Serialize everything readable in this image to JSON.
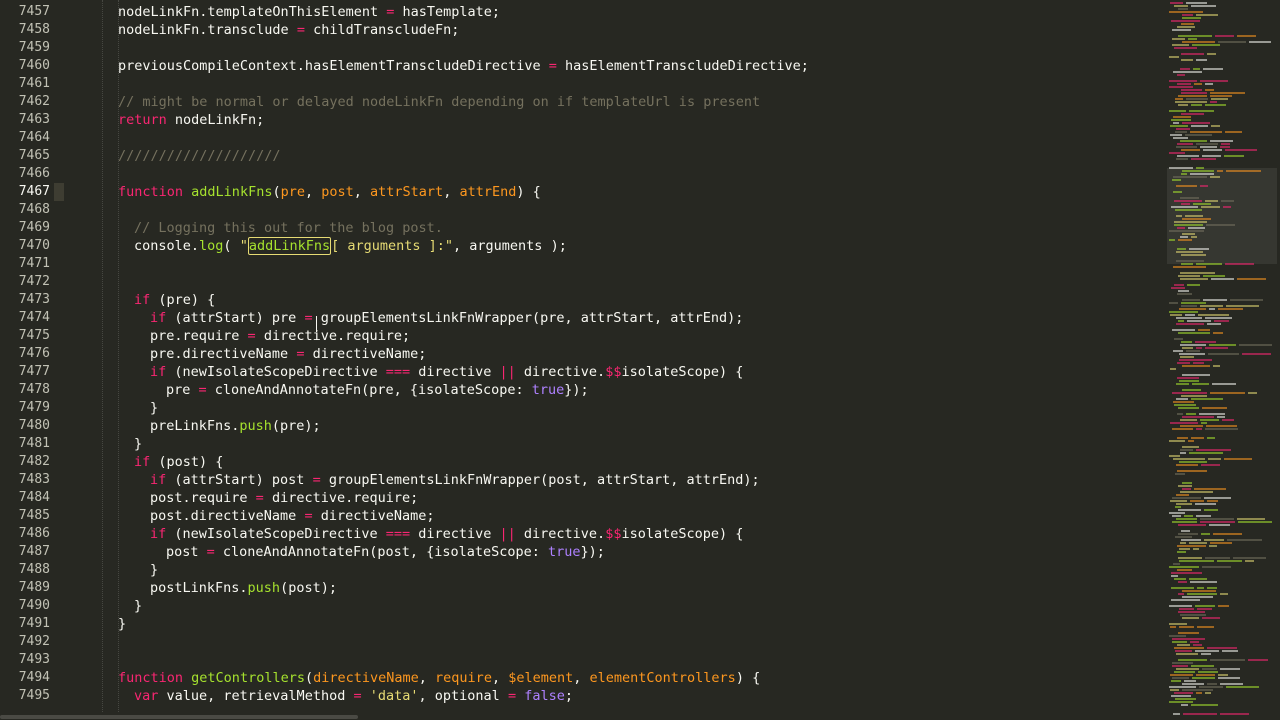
{
  "editor": {
    "active_line": 7467,
    "lines": [
      {
        "n": 7457,
        "indent": 0,
        "tokens": [
          [
            "pl",
            "nodeLinkFn.templateOnThisElement "
          ],
          [
            "kw",
            "="
          ],
          [
            "pl",
            " hasTemplate;"
          ]
        ]
      },
      {
        "n": 7458,
        "indent": 0,
        "tokens": [
          [
            "pl",
            "nodeLinkFn.transclude "
          ],
          [
            "kw",
            "="
          ],
          [
            "pl",
            " childTranscludeFn;"
          ]
        ]
      },
      {
        "n": 7459,
        "indent": 0,
        "tokens": []
      },
      {
        "n": 7460,
        "indent": 0,
        "tokens": [
          [
            "pl",
            "previousCompileContext.hasElementTranscludeDirective "
          ],
          [
            "kw",
            "="
          ],
          [
            "pl",
            " hasElementTranscludeDirective;"
          ]
        ]
      },
      {
        "n": 7461,
        "indent": 0,
        "tokens": []
      },
      {
        "n": 7462,
        "indent": 0,
        "tokens": [
          [
            "cm",
            "// might be normal or delayed nodeLinkFn depending on if templateUrl is present"
          ]
        ]
      },
      {
        "n": 7463,
        "indent": 0,
        "tokens": [
          [
            "kw",
            "return"
          ],
          [
            "pl",
            " nodeLinkFn;"
          ]
        ]
      },
      {
        "n": 7464,
        "indent": 0,
        "tokens": []
      },
      {
        "n": 7465,
        "indent": 0,
        "tokens": [
          [
            "cm",
            "////////////////////"
          ]
        ]
      },
      {
        "n": 7466,
        "indent": 0,
        "tokens": []
      },
      {
        "n": 7467,
        "indent": 0,
        "tokens": [
          [
            "kw",
            "function"
          ],
          [
            "pl",
            " "
          ],
          [
            "fn",
            "addLinkFns"
          ],
          [
            "pl",
            "("
          ],
          [
            "pa",
            "pre"
          ],
          [
            "pl",
            ", "
          ],
          [
            "pa",
            "post"
          ],
          [
            "pl",
            ", "
          ],
          [
            "pa",
            "attrStart"
          ],
          [
            "pl",
            ", "
          ],
          [
            "pa",
            "attrEnd"
          ],
          [
            "pl",
            ") {"
          ]
        ]
      },
      {
        "n": 7468,
        "indent": 0,
        "tokens": []
      },
      {
        "n": 7469,
        "indent": 1,
        "tokens": [
          [
            "cm",
            "// Logging this out for the blog post."
          ]
        ]
      },
      {
        "n": 7470,
        "indent": 1,
        "tokens": [
          [
            "pl",
            "console."
          ],
          [
            "fn",
            "log"
          ],
          [
            "pl",
            "( "
          ],
          [
            "st",
            "\""
          ],
          [
            "hl",
            "addLinkFns"
          ],
          [
            "st",
            "[ arguments ]:\""
          ],
          [
            "pl",
            ", arguments );"
          ]
        ]
      },
      {
        "n": 7471,
        "indent": 0,
        "tokens": []
      },
      {
        "n": 7472,
        "indent": 0,
        "tokens": []
      },
      {
        "n": 7473,
        "indent": 1,
        "tokens": [
          [
            "kw",
            "if"
          ],
          [
            "pl",
            " (pre) {"
          ]
        ]
      },
      {
        "n": 7474,
        "indent": 2,
        "tokens": [
          [
            "kw",
            "if"
          ],
          [
            "pl",
            " (attrStart) pre "
          ],
          [
            "kw",
            "="
          ],
          [
            "pl",
            " groupElementsLinkFnWrapper(pre, attrStart, attrEnd);"
          ]
        ]
      },
      {
        "n": 7475,
        "indent": 2,
        "tokens": [
          [
            "pl",
            "pre.require "
          ],
          [
            "kw",
            "="
          ],
          [
            "pl",
            " directive.require;"
          ]
        ]
      },
      {
        "n": 7476,
        "indent": 2,
        "tokens": [
          [
            "pl",
            "pre.directiveName "
          ],
          [
            "kw",
            "="
          ],
          [
            "pl",
            " directiveName;"
          ]
        ]
      },
      {
        "n": 7477,
        "indent": 2,
        "tokens": [
          [
            "kw",
            "if"
          ],
          [
            "pl",
            " (newIsolateScopeDirective "
          ],
          [
            "kw",
            "==="
          ],
          [
            "pl",
            " directive "
          ],
          [
            "kw",
            "||"
          ],
          [
            "pl",
            " directive."
          ],
          [
            "kw",
            "$$"
          ],
          [
            "pl",
            "isolateScope) {"
          ]
        ]
      },
      {
        "n": 7478,
        "indent": 3,
        "tokens": [
          [
            "pl",
            "pre "
          ],
          [
            "kw",
            "="
          ],
          [
            "pl",
            " cloneAndAnnotateFn(pre, {isolateScope: "
          ],
          [
            "nu",
            "true"
          ],
          [
            "pl",
            "});"
          ]
        ]
      },
      {
        "n": 7479,
        "indent": 2,
        "tokens": [
          [
            "pl",
            "}"
          ]
        ]
      },
      {
        "n": 7480,
        "indent": 2,
        "tokens": [
          [
            "pl",
            "preLinkFns."
          ],
          [
            "fn",
            "push"
          ],
          [
            "pl",
            "(pre);"
          ]
        ]
      },
      {
        "n": 7481,
        "indent": 1,
        "tokens": [
          [
            "pl",
            "}"
          ]
        ]
      },
      {
        "n": 7482,
        "indent": 1,
        "tokens": [
          [
            "kw",
            "if"
          ],
          [
            "pl",
            " (post) {"
          ]
        ]
      },
      {
        "n": 7483,
        "indent": 2,
        "tokens": [
          [
            "kw",
            "if"
          ],
          [
            "pl",
            " (attrStart) post "
          ],
          [
            "kw",
            "="
          ],
          [
            "pl",
            " groupElementsLinkFnWrapper(post, attrStart, attrEnd);"
          ]
        ]
      },
      {
        "n": 7484,
        "indent": 2,
        "tokens": [
          [
            "pl",
            "post.require "
          ],
          [
            "kw",
            "="
          ],
          [
            "pl",
            " directive.require;"
          ]
        ]
      },
      {
        "n": 7485,
        "indent": 2,
        "tokens": [
          [
            "pl",
            "post.directiveName "
          ],
          [
            "kw",
            "="
          ],
          [
            "pl",
            " directiveName;"
          ]
        ]
      },
      {
        "n": 7486,
        "indent": 2,
        "tokens": [
          [
            "kw",
            "if"
          ],
          [
            "pl",
            " (newIsolateScopeDirective "
          ],
          [
            "kw",
            "==="
          ],
          [
            "pl",
            " directive "
          ],
          [
            "kw",
            "||"
          ],
          [
            "pl",
            " directive."
          ],
          [
            "kw",
            "$$"
          ],
          [
            "pl",
            "isolateScope) {"
          ]
        ]
      },
      {
        "n": 7487,
        "indent": 3,
        "tokens": [
          [
            "pl",
            "post "
          ],
          [
            "kw",
            "="
          ],
          [
            "pl",
            " cloneAndAnnotateFn(post, {isolateScope: "
          ],
          [
            "nu",
            "true"
          ],
          [
            "pl",
            "});"
          ]
        ]
      },
      {
        "n": 7488,
        "indent": 2,
        "tokens": [
          [
            "pl",
            "}"
          ]
        ]
      },
      {
        "n": 7489,
        "indent": 2,
        "tokens": [
          [
            "pl",
            "postLinkFns."
          ],
          [
            "fn",
            "push"
          ],
          [
            "pl",
            "(post);"
          ]
        ]
      },
      {
        "n": 7490,
        "indent": 1,
        "tokens": [
          [
            "pl",
            "}"
          ]
        ]
      },
      {
        "n": 7491,
        "indent": 0,
        "tokens": [
          [
            "pl",
            "}"
          ]
        ]
      },
      {
        "n": 7492,
        "indent": 0,
        "tokens": []
      },
      {
        "n": 7493,
        "indent": 0,
        "tokens": []
      },
      {
        "n": 7494,
        "indent": 0,
        "tokens": [
          [
            "kw",
            "function"
          ],
          [
            "pl",
            " "
          ],
          [
            "fn",
            "getControllers"
          ],
          [
            "pl",
            "("
          ],
          [
            "pa",
            "directiveName"
          ],
          [
            "pl",
            ", "
          ],
          [
            "pa",
            "require"
          ],
          [
            "pl",
            ", "
          ],
          [
            "pa",
            "$element"
          ],
          [
            "pl",
            ", "
          ],
          [
            "pa",
            "elementControllers"
          ],
          [
            "pl",
            ") {"
          ]
        ]
      },
      {
        "n": 7495,
        "indent": 1,
        "tokens": [
          [
            "kw",
            "var"
          ],
          [
            "pl",
            " value, retrievalMethod "
          ],
          [
            "kw",
            "="
          ],
          [
            "pl",
            " "
          ],
          [
            "st",
            "'data'"
          ],
          [
            "pl",
            ", optional "
          ],
          [
            "kw",
            "="
          ],
          [
            "pl",
            " "
          ],
          [
            "nu",
            "false"
          ],
          [
            "pl",
            ";"
          ]
        ]
      }
    ]
  },
  "colors": {
    "background": "#272822",
    "keyword": "#F92672",
    "function": "#A6E22E",
    "parameter": "#FD971F",
    "string": "#E6DB74",
    "comment": "#75715E",
    "constant": "#AE81FF",
    "text": "#F8F8F2"
  }
}
